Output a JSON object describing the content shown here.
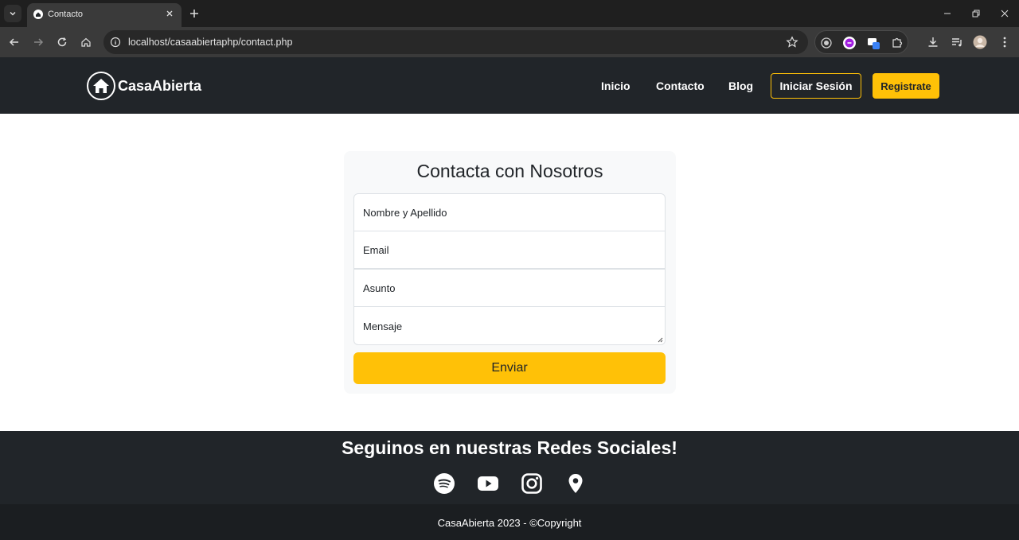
{
  "browser": {
    "tab_title": "Contacto",
    "url": "localhost/casaabiertaphp/contact.php"
  },
  "site": {
    "brand": "CasaAbierta",
    "nav": [
      "Inicio",
      "Contacto",
      "Blog"
    ],
    "login_label": "Iniciar Sesión",
    "register_label": "Registrate",
    "accent": "#ffc107",
    "dark": "#212529"
  },
  "form": {
    "title": "Contacta con Nosotros",
    "fields": {
      "name": "Nombre y Apellido",
      "email": "Email",
      "subject": "Asunto",
      "message": "Mensaje"
    },
    "submit": "Enviar"
  },
  "footer": {
    "social_title": "Seguinos en nuestras Redes Sociales!",
    "social_icons": [
      "spotify-icon",
      "youtube-icon",
      "instagram-icon",
      "location-icon"
    ],
    "copyright": "CasaAbierta 2023 - ©Copyright"
  }
}
